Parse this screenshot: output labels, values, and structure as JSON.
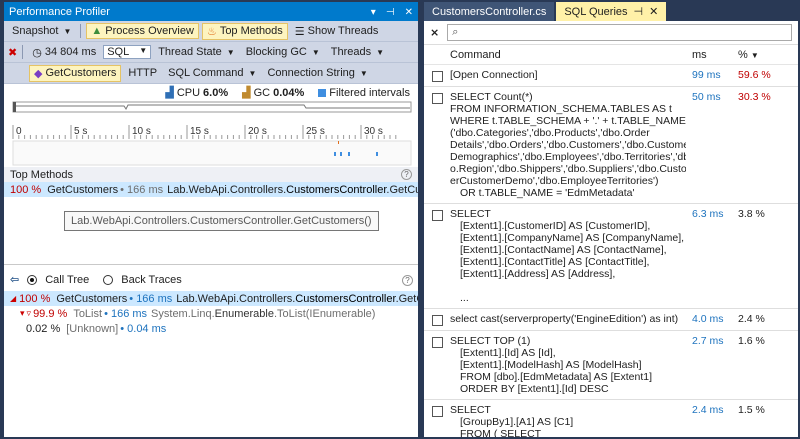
{
  "left": {
    "title": "Performance Profiler",
    "toolbar1": {
      "snapshot": "Snapshot",
      "process_overview": "Process Overview",
      "top_methods": "Top Methods",
      "show_threads": "Show Threads"
    },
    "toolbar2": {
      "time": "34 804 ms",
      "sql": "SQL",
      "thread_state": "Thread State",
      "blocking_gc": "Blocking GC",
      "threads": "Threads"
    },
    "toolbar3": {
      "get_customers": "GetCustomers",
      "http": "HTTP",
      "sql_command": "SQL Command",
      "connection_string": "Connection String"
    },
    "legend": {
      "cpu_label": "CPU",
      "cpu_value": "6.0%",
      "gc_label": "GC",
      "gc_value": "0.04%",
      "filtered": "Filtered intervals"
    },
    "ruler": [
      "0",
      "5 s",
      "10 s",
      "15 s",
      "20 s",
      "25 s",
      "30 s"
    ],
    "top_methods_title": "Top Methods",
    "top_row": {
      "pct": "100 %",
      "method": "GetCustomers",
      "time": "• 166 ms",
      "ns": "Lab.WebApi.Controllers.",
      "cls": "CustomersController",
      "tail": ".GetCusto"
    },
    "tooltip": "Lab.WebApi.Controllers.CustomersController.GetCustomers()",
    "call_tree": "Call Tree",
    "back_traces": "Back Traces",
    "tree": [
      {
        "pct": "100 %",
        "name": "GetCustomers",
        "time": "• 166 ms",
        "ns": "Lab.WebApi.Controllers.",
        "cls": "CustomersController",
        "tail": ".GetCusto"
      },
      {
        "pct": "99.9 %",
        "name": "ToList",
        "time": "• 166 ms",
        "ns": "System.Linq.",
        "cls": "Enumerable",
        "tail": ".ToList(IEnumerable)"
      },
      {
        "pct": "0.02 %",
        "name": "[Unknown]",
        "time": "• 0.04 ms"
      }
    ]
  },
  "right": {
    "tab1": "CustomersController.cs",
    "tab2": "SQL Queries",
    "search_placeholder": "",
    "headers": {
      "command": "Command",
      "ms": "ms",
      "pct": "%"
    },
    "queries": [
      {
        "lines": [
          "[Open Connection]"
        ],
        "ms": "99 ms",
        "pct": "59.6 %",
        "red": true
      },
      {
        "lines": [
          "SELECT Count(*)",
          "FROM INFORMATION_SCHEMA.TABLES AS t",
          "WHERE t.TABLE_SCHEMA + '.' + t.TABLE_NAME IN",
          "('dbo.Categories','dbo.Products','dbo.Order",
          "Details','dbo.Orders','dbo.Customers','dbo.Customer",
          "Demographics','dbo.Employees','dbo.Territories','db",
          "o.Region','dbo.Shippers','dbo.Suppliers','dbo.Custom",
          "erCustomerDemo','dbo.EmployeeTerritories')",
          "    OR t.TABLE_NAME = 'EdmMetadata'"
        ],
        "ms": "50 ms",
        "pct": "30.3 %",
        "red": true
      },
      {
        "lines": [
          "SELECT",
          "    [Extent1].[CustomerID] AS [CustomerID],",
          "    [Extent1].[CompanyName] AS [CompanyName],",
          "    [Extent1].[ContactName] AS [ContactName],",
          "    [Extent1].[ContactTitle] AS [ContactTitle],",
          "    [Extent1].[Address] AS [Address],",
          "",
          "    ..."
        ],
        "ms": "6.3 ms",
        "pct": "3.8 %",
        "red": false
      },
      {
        "lines": [
          "select cast(serverproperty('EngineEdition') as int)"
        ],
        "ms": "4.0 ms",
        "pct": "2.4 %",
        "red": false
      },
      {
        "lines": [
          "SELECT TOP (1)",
          "    [Extent1].[Id] AS [Id],",
          "    [Extent1].[ModelHash] AS [ModelHash]",
          "    FROM [dbo].[EdmMetadata] AS [Extent1]",
          "    ORDER BY [Extent1].[Id] DESC"
        ],
        "ms": "2.7 ms",
        "pct": "1.6 %",
        "red": false
      },
      {
        "lines": [
          "SELECT",
          "    [GroupBy1].[A1] AS [C1]",
          "    FROM ( SELECT"
        ],
        "ms": "2.4 ms",
        "pct": "1.5 %",
        "red": false
      }
    ]
  }
}
